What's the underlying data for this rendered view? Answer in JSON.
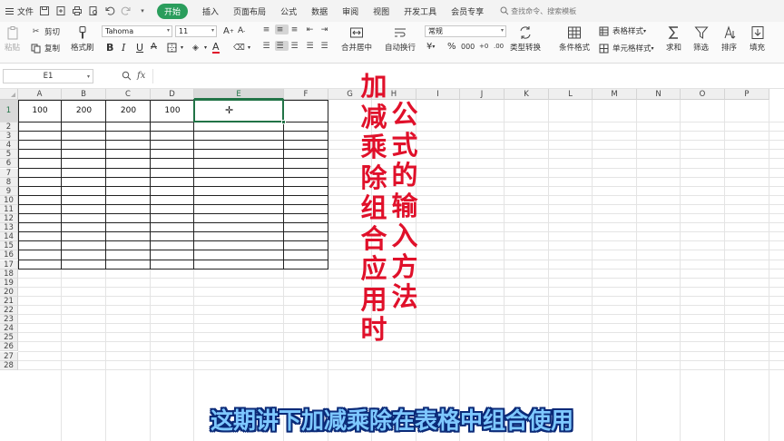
{
  "menu": {
    "file_label": "文件",
    "tabs": [
      "插入",
      "页面布局",
      "公式",
      "数据",
      "审阅",
      "视图",
      "开发工具",
      "会员专享"
    ],
    "active_tab": "开始",
    "search_placeholder": "查找命令、搜索模板"
  },
  "ribbon": {
    "paste_label": "粘贴",
    "cut_label": "剪切",
    "copy_label": "复制",
    "format_painter_label": "格式刷",
    "font_name": "Tahoma",
    "font_size": "11",
    "bold": "B",
    "italic": "I",
    "underline": "U",
    "font_color_glyph": "A",
    "merge_label": "合并居中",
    "wrap_label": "自动换行",
    "number_format": "常规",
    "currency_glyph": "¥",
    "percent_glyph": "%",
    "thousands_glyph": "000",
    "dec_inc": "+0",
    "dec_dec": ".00",
    "type_convert_label": "类型转换",
    "table_style_label": "表格样式",
    "conditional_format_label": "条件格式",
    "cell_style_label": "单元格样式",
    "sum_label": "求和",
    "filter_label": "筛选",
    "sort_label": "排序",
    "fill_label": "填充"
  },
  "formula_bar": {
    "name_box": "E1",
    "fx_label": "fx",
    "content": ""
  },
  "sheet": {
    "columns": [
      "A",
      "B",
      "C",
      "D",
      "E",
      "F",
      "G",
      "H",
      "I",
      "J",
      "K",
      "L",
      "M",
      "N",
      "O",
      "P"
    ],
    "selected_column": "E",
    "rows": [
      "1",
      "2",
      "3",
      "4",
      "5",
      "6",
      "7",
      "8",
      "9",
      "10",
      "11",
      "12",
      "13",
      "14",
      "15",
      "16",
      "17",
      "18",
      "19",
      "20",
      "21",
      "22",
      "23",
      "24",
      "25",
      "26",
      "27",
      "28"
    ],
    "selected_row": "1",
    "active_cell": "E1",
    "row1_values": {
      "A": "100",
      "B": "200",
      "C": "200",
      "D": "100"
    }
  },
  "overlay": {
    "vertical_text_1": "加减乘除组合应用时",
    "vertical_text_2": "公式的输入方法",
    "subtitle": "这期讲下加减乘除在表格中组合使用",
    "accent_color": "#e0102a",
    "subtitle_color": "#7ec8ff"
  }
}
